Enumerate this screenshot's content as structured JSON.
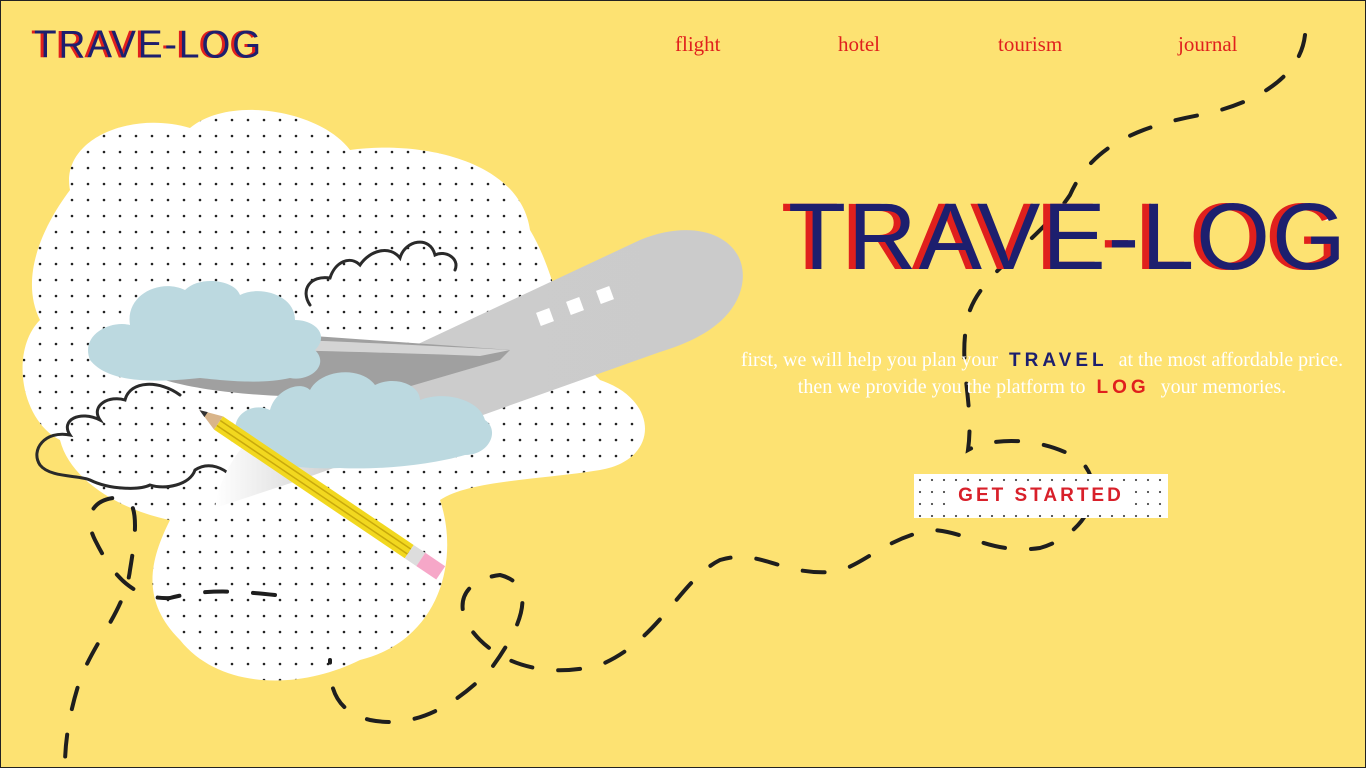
{
  "brand": {
    "logo_text": "TRAVE-LOG"
  },
  "nav": {
    "items": [
      "flight",
      "hotel",
      "tourism",
      "journal"
    ]
  },
  "hero": {
    "title": "TRAVE-LOG",
    "line1": {
      "before": "first, we will help you plan your",
      "highlight": "TRAVEL",
      "after": "at the most affordable price."
    },
    "line2": {
      "before": "then we provide you the platform to",
      "highlight": "LOG",
      "after": "your memories."
    },
    "cta_label": "GET STARTED"
  },
  "colors": {
    "background": "#fde272",
    "navy": "#1d1f6e",
    "red": "#e0201d",
    "cloud": "#bcd9e0",
    "plane": "#cbcbcb",
    "pencil": "#f2d81f"
  }
}
